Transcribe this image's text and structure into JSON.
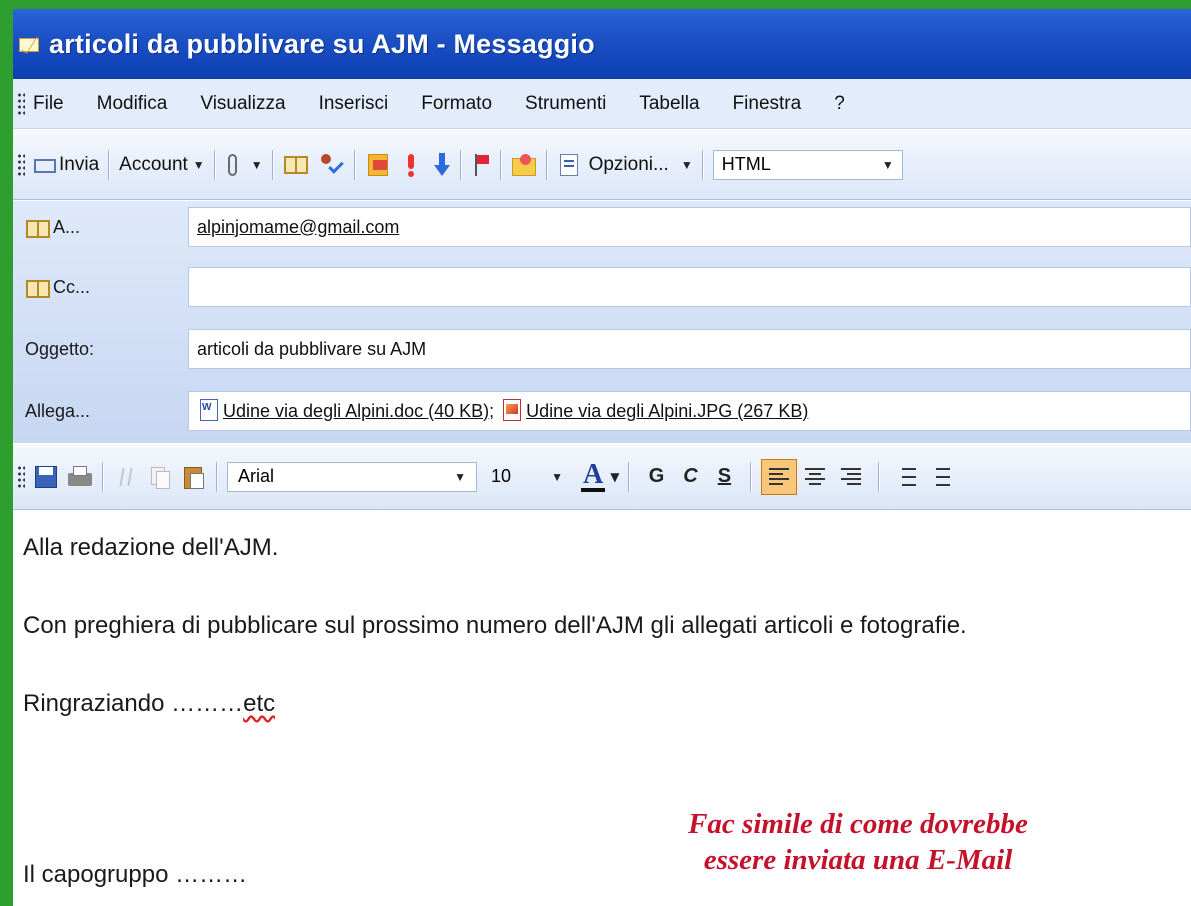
{
  "window": {
    "title": "articoli da pubblivare su AJM - Messaggio"
  },
  "menu": [
    "File",
    "Modifica",
    "Visualizza",
    "Inserisci",
    "Formato",
    "Strumenti",
    "Tabella",
    "Finestra",
    "?"
  ],
  "toolbar": {
    "send_label": "Invia",
    "account_label": "Account",
    "options_label": "Opzioni...",
    "format_value": "HTML"
  },
  "fields": {
    "to_label": "A...",
    "to_value": "alpinjomame@gmail.com",
    "cc_label": "Cc...",
    "cc_value": "",
    "subject_label": "Oggetto:",
    "subject_value": "articoli da pubblivare su AJM",
    "attach_label": "Allega...",
    "attachments": [
      {
        "name": "Udine via degli Alpini.doc (40 KB)",
        "separator": ";",
        "icon": "word-doc-icon"
      },
      {
        "name": "Udine via degli Alpini.JPG (267 KB)",
        "separator": "",
        "icon": "image-file-icon"
      }
    ]
  },
  "format": {
    "font": "Arial",
    "size": "10",
    "bold": "G",
    "italic": "C",
    "underline": "S"
  },
  "body": {
    "line1": "Alla redazione dell'AJM.",
    "line2": "Con preghiera di pubblicare sul prossimo numero dell'AJM gli allegati articoli e fotografie.",
    "line3_prefix": "Ringraziando ………",
    "line3_word": "etc",
    "line4": "Il capogruppo ………"
  },
  "annotation": {
    "line1": "Fac simile di come dovrebbe",
    "line2": "essere inviata una E-Mail"
  },
  "colors": {
    "frame": "#2e9e2e",
    "titlebar": "#1b4fc4",
    "annotation": "#c4122a"
  }
}
